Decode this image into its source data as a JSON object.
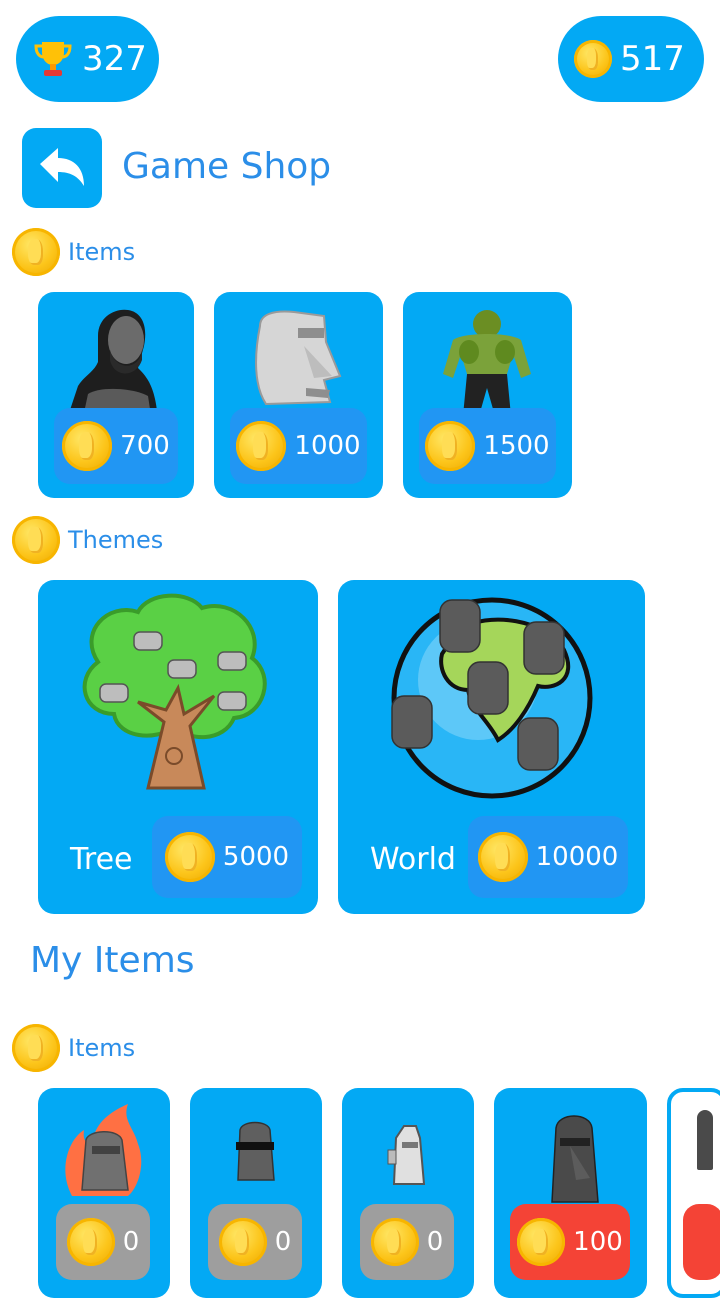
{
  "header": {
    "trophies": "327",
    "coins": "517",
    "colors": {
      "accent": "#03a9f4",
      "title": "#2b8ee8",
      "chip": "#2196f3",
      "owned": "#9e9e9e",
      "price_red": "#f44336"
    }
  },
  "page": {
    "title": "Game Shop"
  },
  "icons": {
    "trophy": "trophy-icon",
    "coin": "coin-icon",
    "back": "back-arrow-icon"
  },
  "shop": {
    "items_label": "Items",
    "items": [
      {
        "name": "gigachad",
        "price": "700"
      },
      {
        "name": "moai",
        "price": "1000"
      },
      {
        "name": "hulk-shrek",
        "price": "1500"
      }
    ],
    "themes_label": "Themes",
    "themes": [
      {
        "label": "Tree",
        "price": "5000"
      },
      {
        "label": "World",
        "price": "10000"
      }
    ]
  },
  "my_items": {
    "title": "My Items",
    "items_label": "Items",
    "items": [
      {
        "name": "fire-moai",
        "value": "0"
      },
      {
        "name": "moai-glasses",
        "value": "0"
      },
      {
        "name": "pixel-moai",
        "value": "0"
      },
      {
        "name": "moai-sunglasses",
        "value": "100"
      }
    ]
  }
}
